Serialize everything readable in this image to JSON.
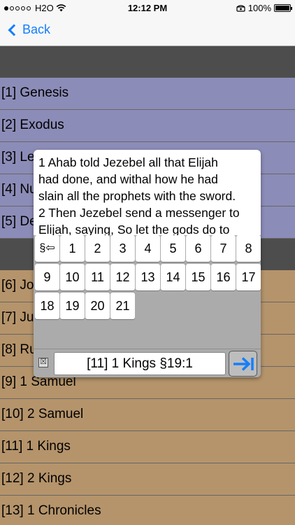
{
  "status_bar": {
    "carrier": "H2O",
    "time": "12:12 PM",
    "battery": "100%",
    "battery_level": 1.0
  },
  "nav": {
    "back_label": "Back"
  },
  "books": [
    "[1] Genesis",
    "[2] Exodus",
    "[3] Le",
    "[4] Nu",
    "[5] De",
    "[6] Jo",
    "[7] Ju",
    "[8] Ru",
    "[9] 1 Samuel",
    "[10] 2 Samuel",
    "[11] 1 Kings",
    "[12] 2 Kings",
    "[13] 1 Chronicles"
  ],
  "popup": {
    "verse_lines": [
      "1 Ahab told Jezebel all that Elijah",
      "had done, and withal how he had",
      "slain all the prophets with the sword.",
      "2 Then Jezebel send a messenger to",
      "Elijah, saying, So let the gods do to"
    ],
    "section_key": "§⇦",
    "chapter_keys": [
      "1",
      "2",
      "3",
      "4",
      "5",
      "6",
      "7",
      "8",
      "9",
      "10",
      "11",
      "12",
      "13",
      "14",
      "15",
      "16",
      "17",
      "18",
      "19",
      "20",
      "21"
    ],
    "clear_symbol": "☒",
    "reference": "[11] 1 Kings §19:1",
    "go_icon": "arrow-to-right-icon",
    "accent_color": "#157efb"
  },
  "colors": {
    "header_gray": "#4d4d4d",
    "purple_rows": "#8c8cb8",
    "tan_rows": "#b5946b"
  }
}
